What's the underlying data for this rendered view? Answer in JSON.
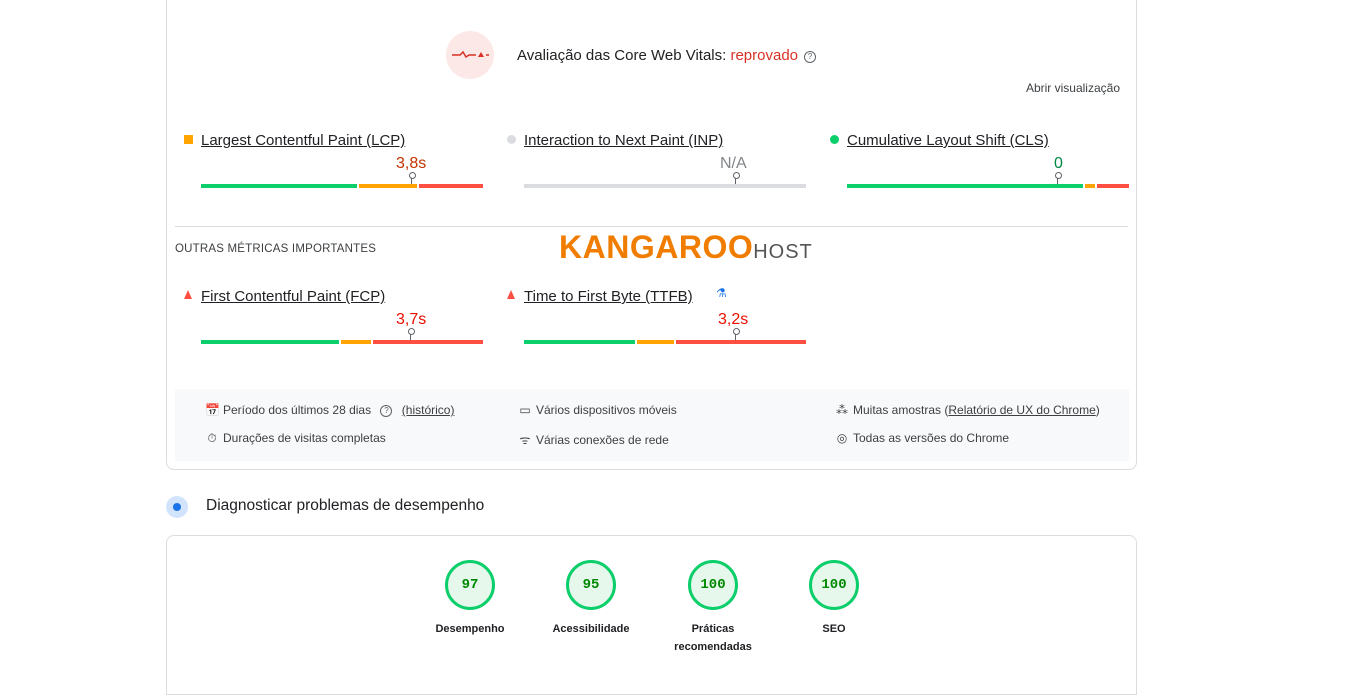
{
  "assessment": {
    "title": "Avaliação das Core Web Vitals: ",
    "status": "reprovado",
    "help_icon": "?",
    "open_view": "Abrir visualização",
    "status_color": "#d93025"
  },
  "core_metrics": [
    {
      "label": "Largest Contentful Paint (LCP)",
      "value": "3,8s",
      "rating": "needs-improvement",
      "marker": "orange-square-icon",
      "value_color": "#c33300"
    },
    {
      "label": "Interaction to Next Paint (INP)",
      "value": "N/A",
      "rating": "none",
      "marker": "gray-dot-icon",
      "value_color": "#80868b"
    },
    {
      "label": "Cumulative Layout Shift (CLS)",
      "value": "0",
      "rating": "good",
      "marker": "green-dot-icon",
      "value_color": "#018642"
    }
  ],
  "other_metrics": {
    "heading": "OUTRAS MÉTRICAS IMPORTANTES",
    "items": [
      {
        "label": "First Contentful Paint (FCP)",
        "value": "3,7s",
        "rating": "poor",
        "marker": "red-triangle-icon",
        "value_color": "#eb0f00"
      },
      {
        "label": "Time to First Byte (TTFB)",
        "value": "3,2s",
        "rating": "poor",
        "marker": "red-triangle-icon",
        "value_color": "#eb0f00",
        "extra_icon": "flask-icon"
      }
    ]
  },
  "logo": {
    "main": "KANGAROO",
    "sub": "HOST"
  },
  "info": {
    "period": "Período dos últimos 28 dias",
    "history_link": "(histórico)",
    "visits": "Durações de visitas completas",
    "devices": "Vários dispositivos móveis",
    "networks": "Várias conexões de rede",
    "samples_prefix": "Muitas amostras (",
    "samples_link": "Relatório de UX do Chrome",
    "samples_suffix": ")",
    "chrome_versions": "Todas as versões do Chrome"
  },
  "diagnose": {
    "title": "Diagnosticar problemas de desempenho"
  },
  "scores": [
    {
      "value": "97",
      "label": "Desempenho"
    },
    {
      "value": "95",
      "label": "Acessibilidade"
    },
    {
      "value": "100",
      "label": "Práticas recomendadas"
    },
    {
      "value": "100",
      "label": "SEO"
    }
  ],
  "colors": {
    "good": "#0cce6b",
    "average": "#ffa400",
    "poor": "#ff4e42",
    "neutral": "#dadce0"
  }
}
